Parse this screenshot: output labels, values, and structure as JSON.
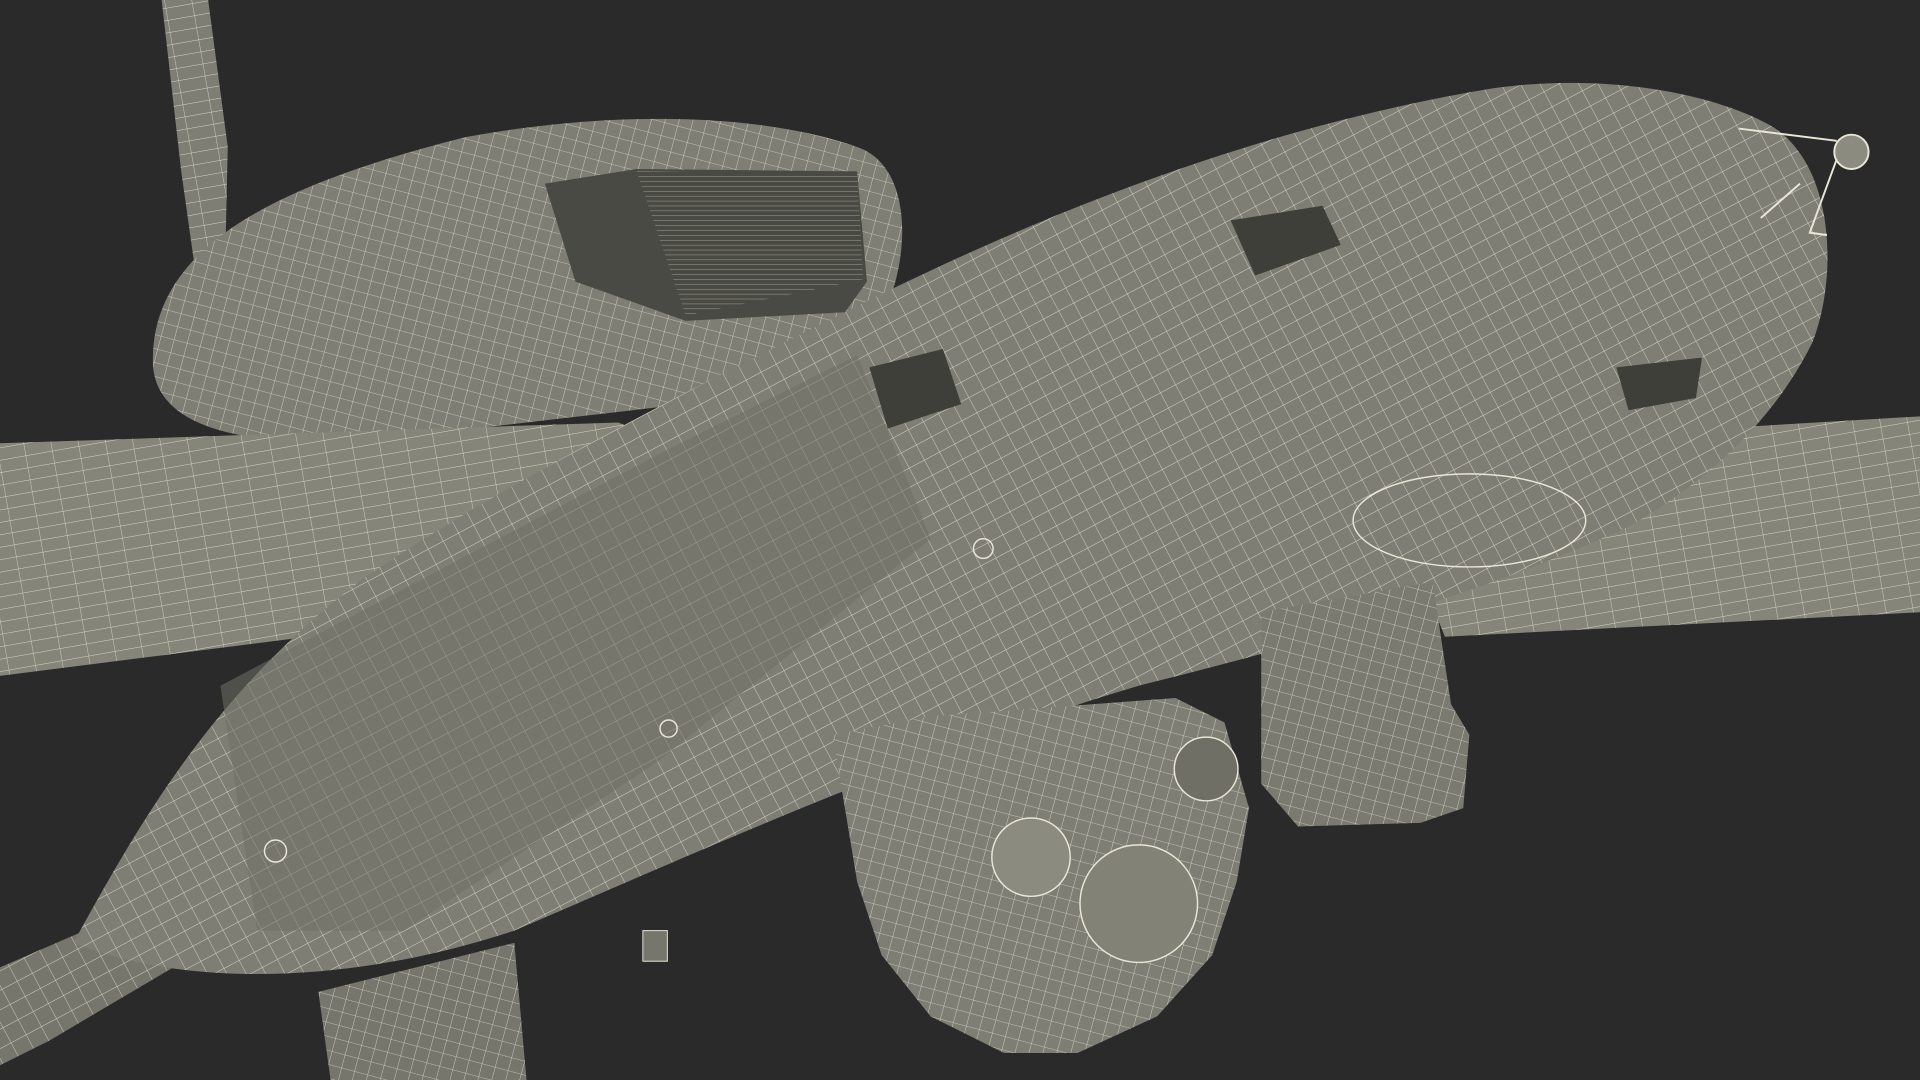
{
  "colors": {
    "background": "#2a2a2a",
    "surface": "#7e7e74",
    "surface_light": "#8b8b80",
    "surface_dark": "#5c5c54",
    "recess": "#3f3f3a",
    "wire": "#e8e6d6"
  }
}
